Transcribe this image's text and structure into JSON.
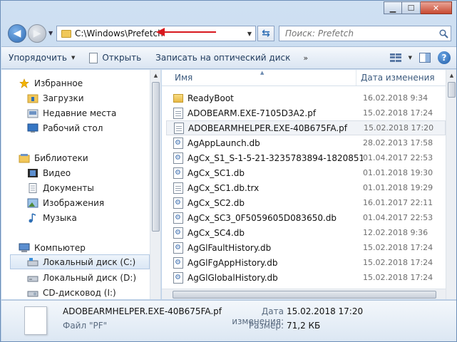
{
  "window": {
    "caption": {
      "minimize": "▁",
      "maximize": "☐",
      "close": "✕"
    }
  },
  "address": {
    "path": "C:\\Windows\\Prefetch",
    "search_placeholder": "Поиск: Prefetch"
  },
  "toolbar": {
    "organize": "Упорядочить",
    "open": "Открыть",
    "burn": "Записать на оптический диск",
    "more": "»"
  },
  "nav": {
    "items": [
      {
        "label": "Избранное",
        "icon": "star-icon"
      },
      {
        "label": "Загрузки",
        "icon": "downloads-folder-icon"
      },
      {
        "label": "Недавние места",
        "icon": "recent-places-icon"
      },
      {
        "label": "Рабочий стол",
        "icon": "desktop-icon"
      },
      {
        "label": "Библиотеки",
        "icon": "libraries-icon"
      },
      {
        "label": "Видео",
        "icon": "video-icon"
      },
      {
        "label": "Документы",
        "icon": "documents-icon"
      },
      {
        "label": "Изображения",
        "icon": "images-icon"
      },
      {
        "label": "Музыка",
        "icon": "music-icon"
      },
      {
        "label": "Компьютер",
        "icon": "computer-icon"
      },
      {
        "label": "Локальный диск (C:)",
        "icon": "drive-c-icon"
      },
      {
        "label": "Локальный диск (D:)",
        "icon": "drive-d-icon"
      },
      {
        "label": "CD-дисковод (I:)",
        "icon": "cd-drive-icon"
      }
    ]
  },
  "files": {
    "headers": {
      "name": "Имя",
      "date": "Дата изменения"
    },
    "rows": [
      {
        "name": "ReadyBoot",
        "date": "16.02.2018 9:34",
        "icon": "folder-icon"
      },
      {
        "name": "ADOBEARM.EXE-7105D3A2.pf",
        "date": "15.02.2018 17:24",
        "icon": "file-icon"
      },
      {
        "name": "ADOBEARMHELPER.EXE-40B675FA.pf",
        "date": "15.02.2018 17:20",
        "icon": "file-icon"
      },
      {
        "name": "AgAppLaunch.db",
        "date": "28.02.2013 17:58",
        "icon": "db-file-icon"
      },
      {
        "name": "AgCx_S1_S-1-5-21-3235783894-18208517...",
        "date": "01.04.2017 22:53",
        "icon": "db-file-icon"
      },
      {
        "name": "AgCx_SC1.db",
        "date": "01.01.2018 19:30",
        "icon": "db-file-icon"
      },
      {
        "name": "AgCx_SC1.db.trx",
        "date": "01.01.2018 19:29",
        "icon": "file-icon"
      },
      {
        "name": "AgCx_SC2.db",
        "date": "16.01.2017 22:11",
        "icon": "db-file-icon"
      },
      {
        "name": "AgCx_SC3_0F5059605D083650.db",
        "date": "01.04.2017 22:53",
        "icon": "db-file-icon"
      },
      {
        "name": "AgCx_SC4.db",
        "date": "12.02.2018 9:36",
        "icon": "db-file-icon"
      },
      {
        "name": "AgGlFaultHistory.db",
        "date": "15.02.2018 17:24",
        "icon": "db-file-icon"
      },
      {
        "name": "AgGlFgAppHistory.db",
        "date": "15.02.2018 17:24",
        "icon": "db-file-icon"
      },
      {
        "name": "AgGlGlobalHistory.db",
        "date": "15.02.2018 17:24",
        "icon": "db-file-icon"
      }
    ],
    "selected_index": 2
  },
  "details": {
    "name": "ADOBEARMHELPER.EXE-40B675FA.pf",
    "type": "Файл \"PF\"",
    "date_label": "Дата изменения:",
    "date_value": "15.02.2018 17:20",
    "size_label": "Размер:",
    "size_value": "71,2 КБ"
  }
}
